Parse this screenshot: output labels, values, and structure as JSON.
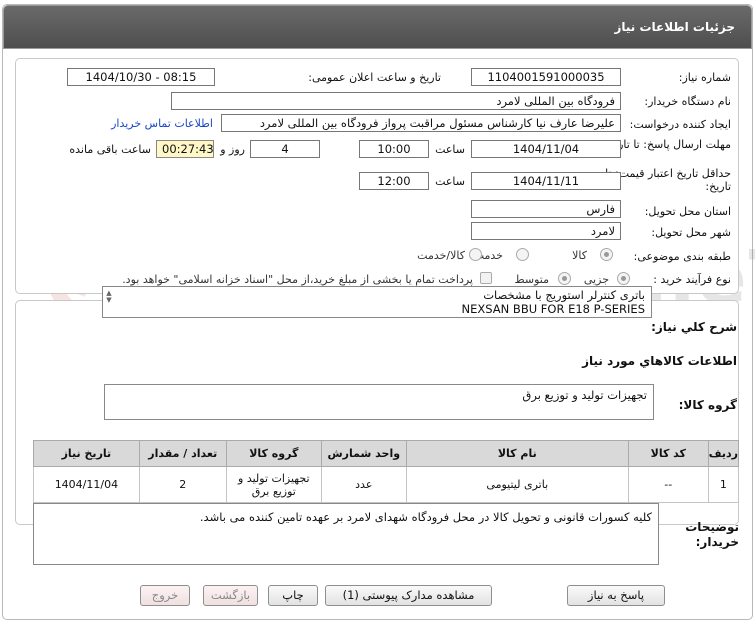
{
  "window_title": "جزئیات اطلاعات نیاز",
  "labels": {
    "need_number": "شماره نیاز:",
    "announce_datetime": "تاریخ و ساعت اعلان عمومی:",
    "buyer_org": "نام دستگاه خریدار:",
    "requester": "ایجاد کننده درخواست:",
    "contact_link": "اطلاعات تماس خریدار",
    "reply_deadline": "مهلت ارسال پاسخ: تا تاریخ:",
    "time_word": "ساعت",
    "days_word": "روز و",
    "remaining_word": "ساعت باقی مانده",
    "price_validity": "حداقل تاریخ اعتبار قیمت: تا تاریخ:",
    "province": "استان محل تحویل:",
    "city": "شهر محل تحویل:",
    "category": "طبقه بندی موضوعی:",
    "purchase_type": "نوع فرآیند خرید :",
    "description_title": "شرح کلي نياز:",
    "goods_info_title": "اطلاعات کالاهاي مورد نياز",
    "goods_group_title": "گروه کالا:",
    "buyer_notes_title": "توضیحات خریدار:"
  },
  "values": {
    "need_number": "1104001591000035",
    "announce_datetime": "1404/10/30 - 08:15",
    "buyer_org": "فرودگاه بین المللی لامرد",
    "requester": "علیرضا عارف نیا کارشناس مسئول مراقبت پرواز فرودگاه بین المللی لامرد",
    "reply_date": "1404/11/04",
    "reply_time": "10:00",
    "days_left": "4",
    "time_left": "00:27:43",
    "validity_date": "1404/11/11",
    "validity_time": "12:00",
    "province": "فارس",
    "city": "لامرد",
    "description_line1": "باتری کنترلر استوریج با مشخصات",
    "description_line2": "NEXSAN BBU FOR E18 P-SERIES",
    "goods_group": "تجهیزات تولید و توزیع برق",
    "buyer_notes": "کلیه کسورات قانونی و تحویل کالا در محل فرودگاه شهدای لامرد بر عهده تامین کننده می باشد."
  },
  "category_options": [
    {
      "label": "کالا",
      "selected": true
    },
    {
      "label": "خدمت",
      "selected": false
    },
    {
      "label": "کالا/خدمت",
      "selected": false
    }
  ],
  "purchase_options": [
    {
      "label": "جزیی",
      "selected": true
    },
    {
      "label": "متوسط",
      "selected": false
    }
  ],
  "treasury_note": "پرداخت تمام یا بخشی از مبلغ خرید،از محل \"اسناد خزانه اسلامی\" خواهد بود.",
  "table": {
    "headers": [
      "ردیف",
      "کد کالا",
      "نام کالا",
      "واحد شمارش",
      "گروه کالا",
      "تعداد / مقدار",
      "تاریخ نیاز"
    ],
    "rows": [
      {
        "row": "1",
        "code": "--",
        "name": "باتری لیتیومی",
        "unit": "عدد",
        "group": "تجهیزات تولید و توزیع برق",
        "qty": "2",
        "date": "1404/11/04"
      }
    ]
  },
  "buttons": {
    "reply": "پاسخ به نیاز",
    "attachments": "مشاهده مدارک پیوستی (1)",
    "print": "چاپ",
    "back": "بازگشت",
    "exit": "خروج"
  },
  "watermark": "AriaTender.neT"
}
